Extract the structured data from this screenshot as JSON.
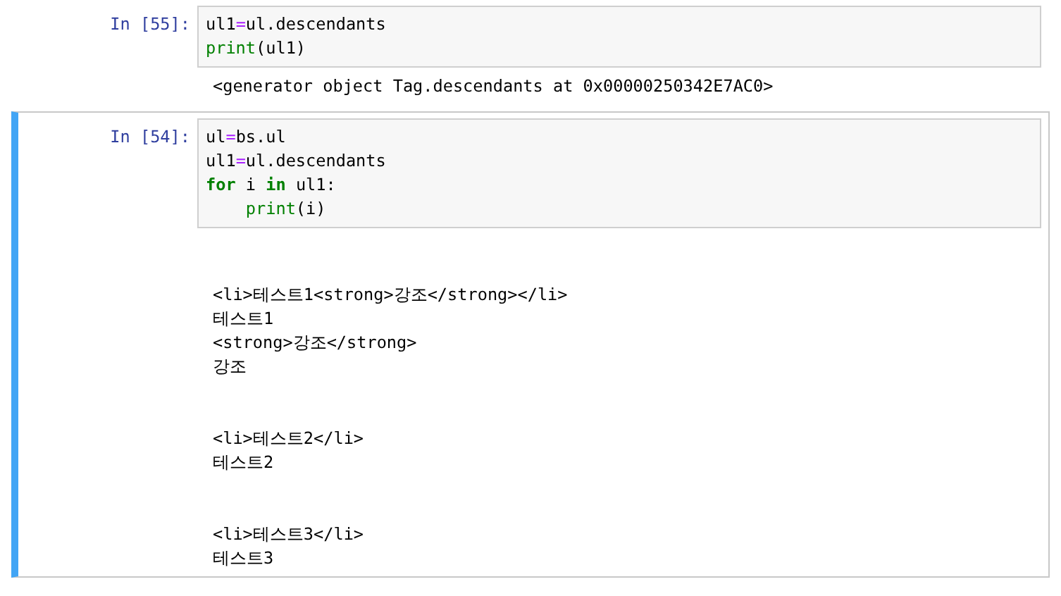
{
  "cells": [
    {
      "prompt": "In [55]:",
      "selected": false,
      "code": [
        [
          {
            "kind": "name",
            "text": "ul1"
          },
          {
            "kind": "op",
            "text": "="
          },
          {
            "kind": "name",
            "text": "ul.descendants"
          }
        ],
        [
          {
            "kind": "builtin",
            "text": "print"
          },
          {
            "kind": "name",
            "text": "(ul1)"
          }
        ]
      ],
      "output": [
        {
          "lines": [
            "<generator object Tag.descendants at 0x00000250342E7AC0>"
          ]
        }
      ]
    },
    {
      "prompt": "In [54]:",
      "selected": true,
      "code": [
        [
          {
            "kind": "name",
            "text": "ul"
          },
          {
            "kind": "op",
            "text": "="
          },
          {
            "kind": "name",
            "text": "bs.ul"
          }
        ],
        [
          {
            "kind": "name",
            "text": "ul1"
          },
          {
            "kind": "op",
            "text": "="
          },
          {
            "kind": "name",
            "text": "ul.descendants"
          }
        ],
        [
          {
            "kind": "keyword",
            "text": "for"
          },
          {
            "kind": "name",
            "text": " i "
          },
          {
            "kind": "keyword",
            "text": "in"
          },
          {
            "kind": "name",
            "text": " ul1:"
          }
        ],
        [
          {
            "kind": "indent"
          },
          {
            "kind": "builtin",
            "text": "print"
          },
          {
            "kind": "name",
            "text": "(i)"
          }
        ]
      ],
      "output": [
        {
          "lines": [
            "<li>테스트1<strong>강조</strong></li>",
            "테스트1",
            "<strong>강조</strong>",
            "강조"
          ]
        },
        {
          "lines": [
            "<li>테스트2</li>",
            "테스트2"
          ]
        },
        {
          "lines": [
            "<li>테스트3</li>",
            "테스트3"
          ]
        }
      ]
    }
  ]
}
